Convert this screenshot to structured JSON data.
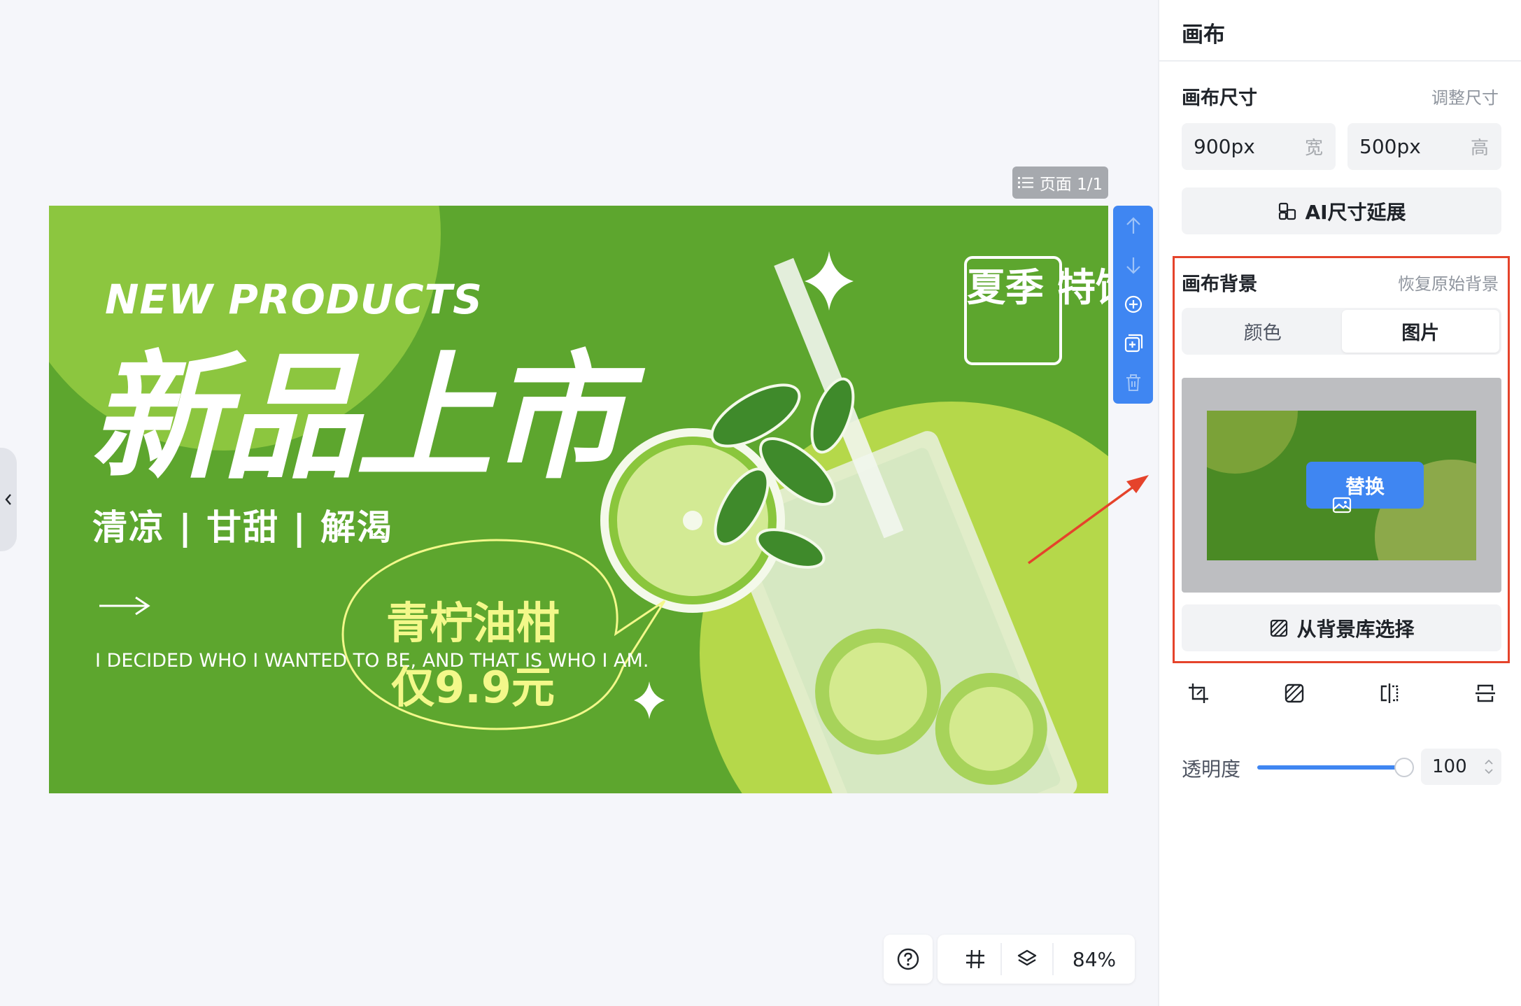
{
  "canvas": {
    "page_indicator": "页面 1/1",
    "zoom": "84%"
  },
  "poster": {
    "headline_en": "NEW PRODUCTS",
    "headline_zh": "新品上市",
    "subtitle": "清凉 | 甘甜 | 解渴",
    "quote": "I DECIDED WHO I\nWANTED TO BE,\nAND THAT IS WHO I AM.",
    "badge": "夏季\n特饮",
    "bubble_line1": "青柠油柑",
    "bubble_line2": "仅9.9元",
    "colors": {
      "bg": "#5da62e",
      "light": "#b5d84a",
      "accent_text": "#f3f88a"
    }
  },
  "side_toolbar": [
    "move-up-icon",
    "move-down-icon",
    "add-page-icon",
    "duplicate-page-icon",
    "delete-icon"
  ],
  "bottom_bar": [
    "help-icon",
    "grid-icon",
    "layers-icon"
  ],
  "panel": {
    "title": "画布",
    "size_section": {
      "label": "画布尺寸",
      "link": "调整尺寸",
      "width_value": "900px",
      "width_unit": "宽",
      "height_value": "500px",
      "height_unit": "高",
      "ai_button": "AI尺寸延展"
    },
    "bg_section": {
      "label": "画布背景",
      "link": "恢复原始背景",
      "tab_color": "颜色",
      "tab_image": "图片",
      "replace_button": "替换",
      "library_button": "从背景库选择"
    },
    "tools": [
      "crop-icon",
      "filter-icon",
      "flip-horizontal-icon",
      "flip-vertical-icon"
    ],
    "opacity": {
      "label": "透明度",
      "value": "100",
      "level": 100
    }
  },
  "colors": {
    "accent": "#3f86f2",
    "highlight": "#e5432b"
  }
}
